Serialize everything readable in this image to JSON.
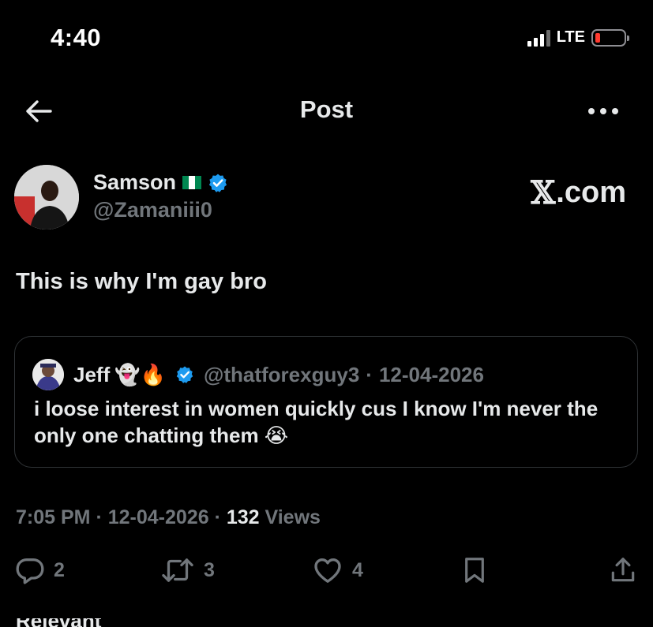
{
  "status_bar": {
    "time": "4:40",
    "network": "LTE",
    "battery_level": 0.1,
    "battery_color": "#ff3b30"
  },
  "header": {
    "title": "Post",
    "back_icon": "back-arrow-icon",
    "more_icon": "more-horizontal-icon"
  },
  "author": {
    "name": "Samson",
    "flag": "🇳🇬",
    "verified": true,
    "handle": "@Zamaniii0"
  },
  "watermark": {
    "x": "𝕏",
    "domain": ".com"
  },
  "post": {
    "text": "This is why I'm gay bro"
  },
  "quoted": {
    "name": "Jeff",
    "emojis": "👻🔥",
    "verified": true,
    "handle": "@thatforexguy3",
    "separator": "·",
    "date": "12-04-2026",
    "text": "i loose interest in women quickly cus I know I'm never the only one chatting them 😭"
  },
  "meta": {
    "time": "7:05 PM",
    "sep1": "·",
    "date": "12-04-2026",
    "sep2": "·",
    "views_count": "132",
    "views_label": "Views"
  },
  "actions": {
    "replies": "2",
    "reposts": "3",
    "likes": "4"
  },
  "footer": {
    "peek_text": "Relevant"
  },
  "colors": {
    "background": "#000000",
    "text_primary": "#e7e9ea",
    "text_secondary": "#71767b",
    "border": "#2f3336",
    "verified_blue": "#1d9bf0"
  }
}
